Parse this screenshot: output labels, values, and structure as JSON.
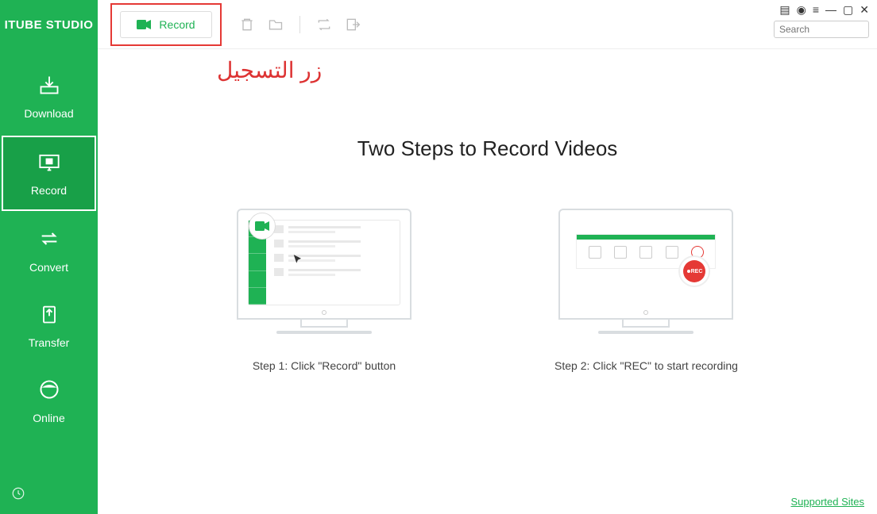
{
  "app": {
    "title": "ITUBE STUDIO"
  },
  "sidebar": {
    "items": [
      {
        "label": "Download",
        "icon": "download-icon"
      },
      {
        "label": "Record",
        "icon": "record-icon"
      },
      {
        "label": "Convert",
        "icon": "convert-icon"
      },
      {
        "label": "Transfer",
        "icon": "transfer-icon"
      },
      {
        "label": "Online",
        "icon": "online-icon"
      }
    ]
  },
  "toolbar": {
    "record_label": "Record"
  },
  "search": {
    "placeholder": "Search"
  },
  "annotation": {
    "text": "زر التسجيل"
  },
  "content": {
    "heading": "Two Steps to Record Videos",
    "step1_caption": "Step 1: Click \"Record\" button",
    "step2_caption": "Step 2: Click \"REC\" to start recording",
    "rec_label": "REC"
  },
  "footer": {
    "supported_sites": "Supported Sites"
  }
}
